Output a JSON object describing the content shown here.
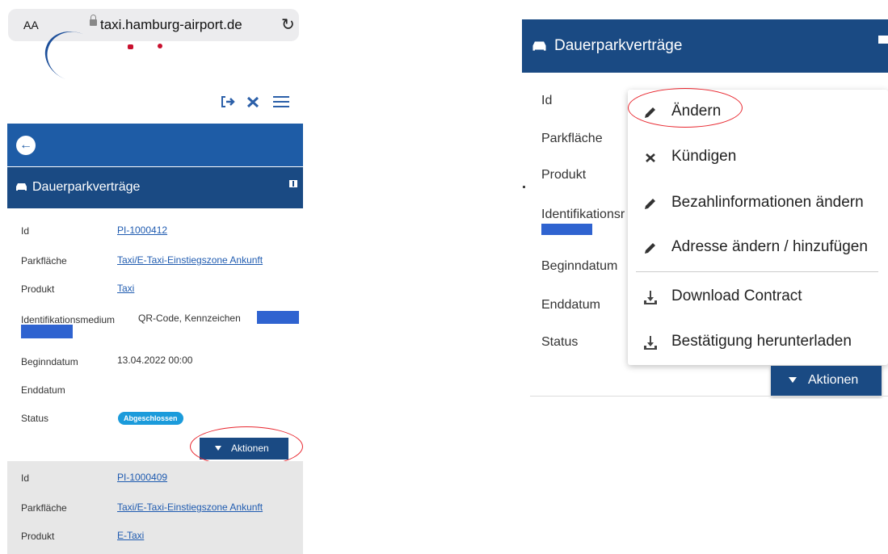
{
  "browser": {
    "text_size_label": "AA",
    "url": "taxi.hamburg-airport.de",
    "reload_icon": "reload-icon"
  },
  "colors": {
    "primary": "#1a4a83",
    "back_bar": "#1e5ca6",
    "link": "#1f5bb0",
    "badge": "#1b9bdb",
    "redaction": "#2f63d0",
    "highlight_oval": "#e8262e"
  },
  "left": {
    "toolbar_icons": [
      "logout-icon",
      "close-icon",
      "menu-icon"
    ],
    "section_title": "Dauerparkverträge",
    "contract1": {
      "id_label": "Id",
      "id_value": "PI-1000412",
      "area_label": "Parkfläche",
      "area_value": "Taxi/E-Taxi-Einstiegszone Ankunft",
      "product_label": "Produkt",
      "product_value": "Taxi",
      "medium_label": "Identifikationsmedium",
      "medium_value": "QR-Code, Kennzeichen",
      "start_label": "Beginndatum",
      "start_value": "13.04.2022 00:00",
      "end_label": "Enddatum",
      "end_value": "",
      "status_label": "Status",
      "status_value": "Abgeschlossen",
      "actions_label": "Aktionen"
    },
    "contract2": {
      "id_label": "Id",
      "id_value": "PI-1000409",
      "area_label": "Parkfläche",
      "area_value": "Taxi/E-Taxi-Einstiegszone Ankunft",
      "product_label": "Produkt",
      "product_value": "E-Taxi"
    }
  },
  "right": {
    "section_title": "Dauerparkverträge",
    "labels": {
      "id": "Id",
      "area": "Parkfläche",
      "product": "Produkt",
      "medium": "Identifikationsr",
      "start": "Beginndatum",
      "end": "Enddatum",
      "status": "Status"
    },
    "menu": [
      {
        "label": "Ändern",
        "icon": "pencil-icon"
      },
      {
        "label": "Kündigen",
        "icon": "x-icon"
      },
      {
        "label": "Bezahlinformationen ändern",
        "icon": "pencil-icon"
      },
      {
        "label": "Adresse ändern / hinzufügen",
        "icon": "pencil-icon"
      },
      {
        "label": "Download Contract",
        "icon": "download-icon"
      },
      {
        "label": "Bestätigung herunterladen",
        "icon": "download-icon"
      }
    ],
    "actions_label": "Aktionen"
  }
}
